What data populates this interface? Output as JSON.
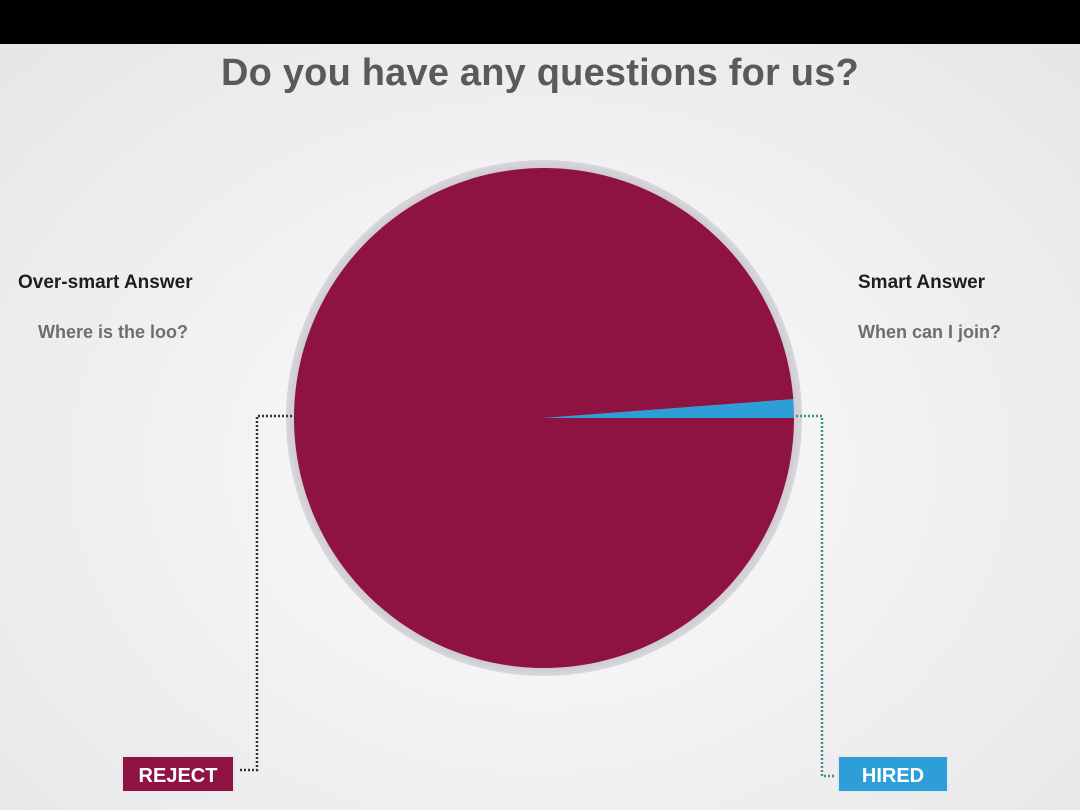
{
  "chart_data": {
    "type": "pie",
    "title": "Do you have any questions for us?",
    "slices": [
      {
        "label": "REJECT",
        "value": 98.8,
        "color": "#8e1343"
      },
      {
        "label": "HIRED",
        "value": 1.2,
        "color": "#2d9ed8"
      }
    ],
    "annotations": {
      "left": {
        "heading": "Over-smart Answer",
        "text": "Where is the loo?",
        "tag": "REJECT"
      },
      "right": {
        "heading": "Smart Answer",
        "text": "When can I join?",
        "tag": "HIRED"
      }
    },
    "legend": "none"
  },
  "colors": {
    "reject": "#8e1343",
    "hired": "#2d9ed8",
    "pie_rim": "#a9a5ab",
    "connector": "#3a3a3a"
  }
}
